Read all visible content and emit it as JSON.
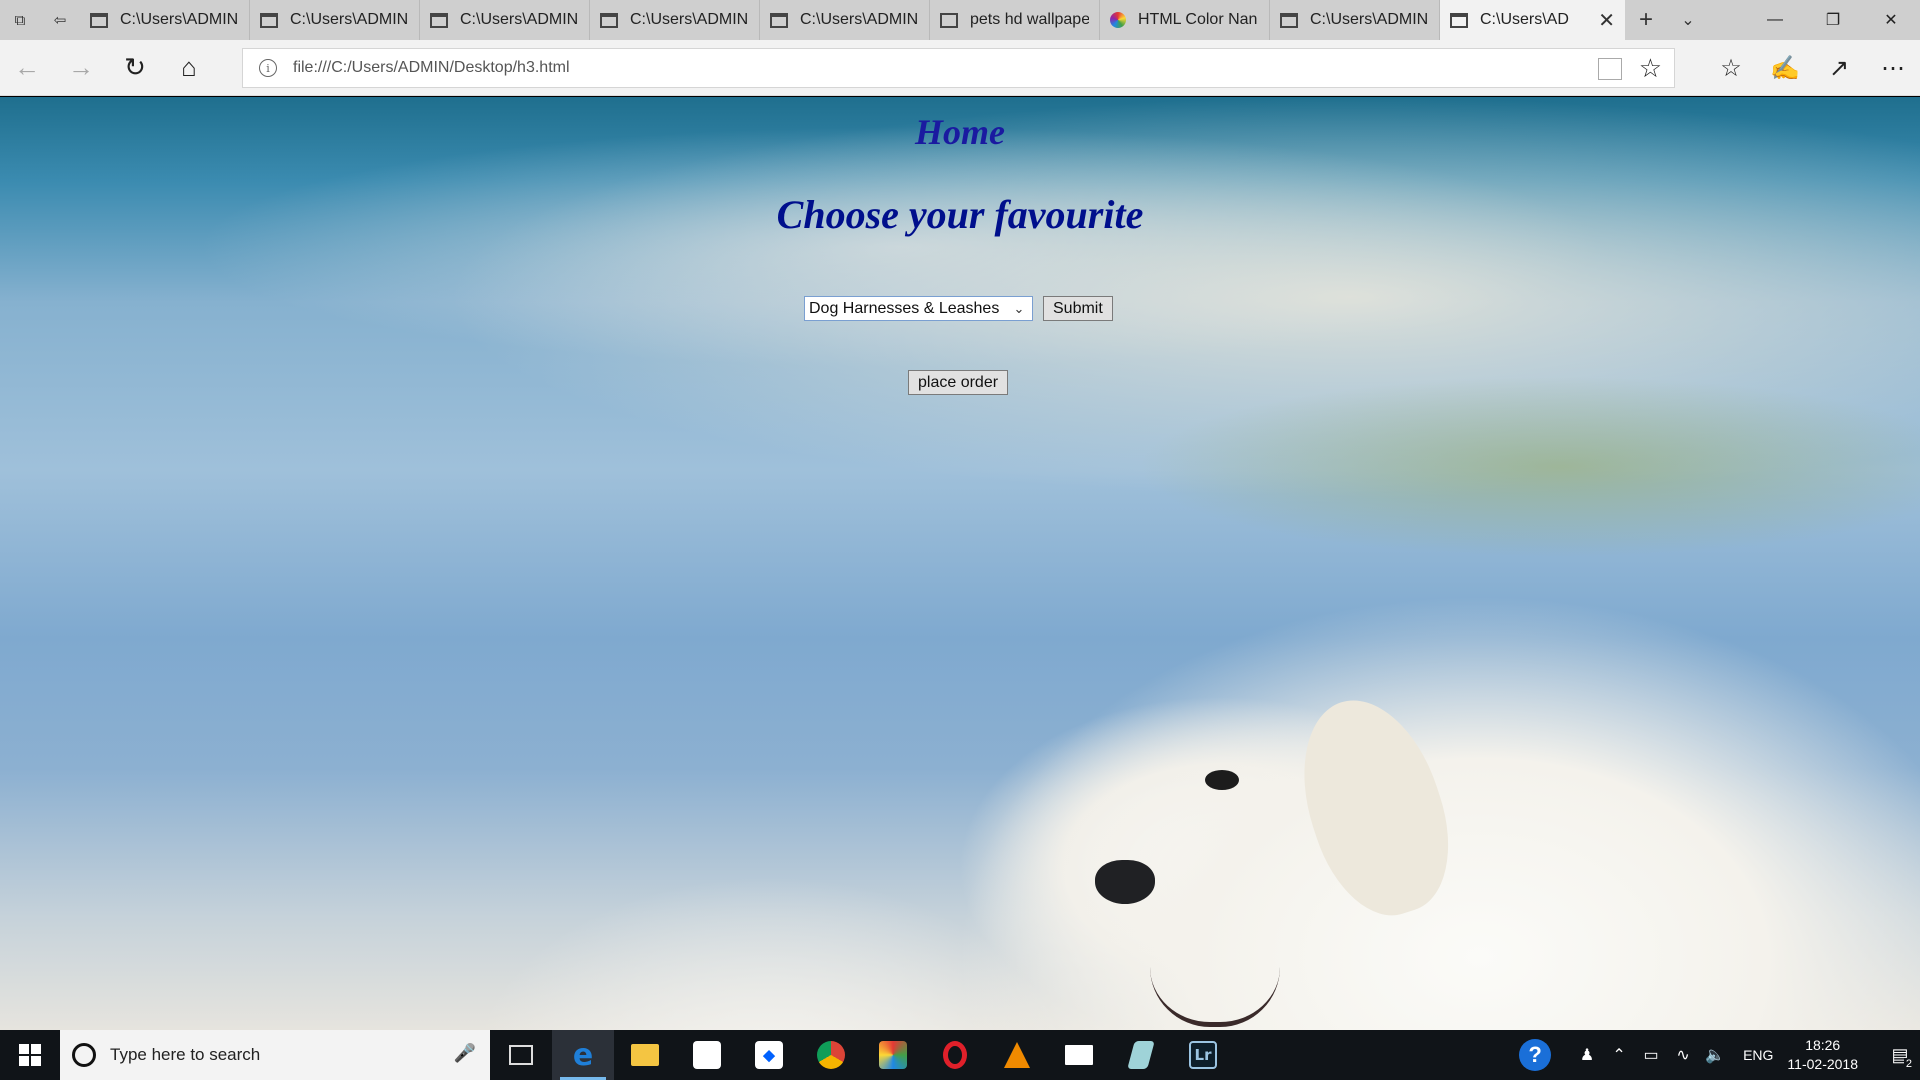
{
  "browser": {
    "tabs": [
      {
        "label": "C:\\Users\\ADMIN",
        "icon": "page-icon"
      },
      {
        "label": "C:\\Users\\ADMIN",
        "icon": "page-icon"
      },
      {
        "label": "C:\\Users\\ADMIN",
        "icon": "page-icon"
      },
      {
        "label": "C:\\Users\\ADMIN",
        "icon": "page-icon"
      },
      {
        "label": "C:\\Users\\ADMIN",
        "icon": "page-icon"
      },
      {
        "label": "pets hd wallpape",
        "icon": "page-icon"
      },
      {
        "label": "HTML Color Nan",
        "icon": "color-wheel-icon"
      },
      {
        "label": "C:\\Users\\ADMIN",
        "icon": "page-icon"
      }
    ],
    "active_tab": {
      "label": "C:\\Users\\AD",
      "icon": "page-icon"
    },
    "address": "file:///C:/Users/ADMIN/Desktop/h3.html"
  },
  "page": {
    "heading": "Home",
    "subheading": "Choose your favourite",
    "select": {
      "selected": "Dog Harnesses & Leashes"
    },
    "submit_label": "Submit",
    "order_label": "place order"
  },
  "taskbar": {
    "search_placeholder": "Type here to search",
    "apps": [
      "task-view-icon",
      "edge-icon",
      "file-explorer-icon",
      "store-icon",
      "dropbox-icon",
      "chrome-icon",
      "paint-icon",
      "opera-icon",
      "vlc-icon",
      "mail-icon",
      "pencil-app-icon",
      "lightroom-icon"
    ],
    "lightroom_label": "Lr",
    "language": "ENG",
    "time": "18:26",
    "date": "11-02-2018",
    "notification_count": "2"
  },
  "colors": {
    "heading": "#1a1aa0",
    "subheading": "#000f8c",
    "taskbar": "#101418",
    "accent": "#76b9ed"
  }
}
